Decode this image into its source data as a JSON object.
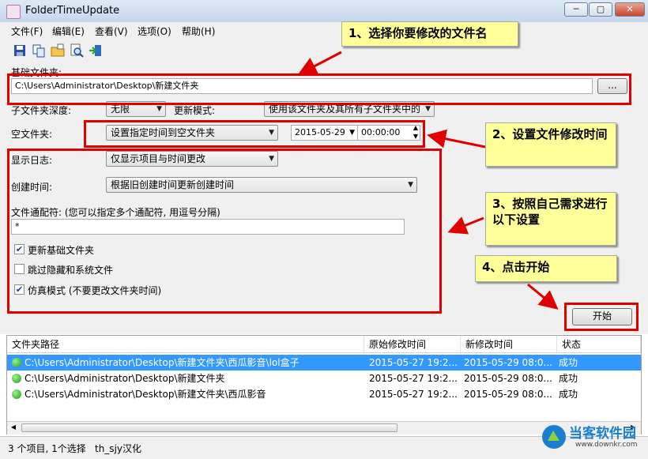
{
  "window": {
    "title": "FolderTimeUpdate"
  },
  "menu": [
    "文件(F)",
    "编辑(E)",
    "查看(V)",
    "选项(O)",
    "帮助(H)"
  ],
  "toolbar_icons": [
    "save-icon",
    "copy-icon",
    "open-folder-icon",
    "search-icon",
    "exit-icon"
  ],
  "form": {
    "base_folder_label": "基础文件夹:",
    "base_folder_value": "C:\\Users\\Administrator\\Desktop\\新建文件夹",
    "browse_label": "...",
    "subfolder_depth_label": "子文件夹深度:",
    "subfolder_depth_value": "无限",
    "update_mode_label": "更新模式:",
    "update_mode_value": "使用该文件夹及其所有子文件夹中的",
    "empty_folder_label": "空文件夹:",
    "empty_folder_value": "设置指定时间到空文件夹",
    "date_value": "2015-05-29",
    "time_value": "00:00:00",
    "log_label": "显示日志:",
    "log_value": "仅显示项目与时间更改",
    "create_time_label": "创建时间:",
    "create_time_value": "根据旧创建时间更新创建时间",
    "wildcard_label": "文件通配符: (您可以指定多个通配符, 用逗号分隔)",
    "wildcard_value": "*",
    "checkboxes": [
      {
        "label": "更新基础文件夹",
        "checked": true
      },
      {
        "label": "跳过隐藏和系统文件",
        "checked": false
      },
      {
        "label": "仿真模式 (不要更改文件夹时间)",
        "checked": true
      }
    ],
    "start_label": "开始"
  },
  "annotations": [
    "1、选择你要修改的文件名",
    "2、设置文件修改时间",
    "3、按照自己需求进行以下设置",
    "4、点击开始"
  ],
  "table": {
    "columns": [
      "文件夹路径",
      "原始修改时间",
      "新修改时间",
      "状态"
    ],
    "rows": [
      {
        "path": "C:\\Users\\Administrator\\Desktop\\新建文件夹\\西瓜影音\\lol盒子",
        "orig": "2015-05-27 19:2...",
        "new": "2015-05-29 08:0...",
        "status": "成功",
        "selected": true
      },
      {
        "path": "C:\\Users\\Administrator\\Desktop\\新建文件夹",
        "orig": "2015-05-27 19:2...",
        "new": "2015-05-29 08:0...",
        "status": "成功",
        "selected": false
      },
      {
        "path": "C:\\Users\\Administrator\\Desktop\\新建文件夹\\西瓜影音",
        "orig": "2015-05-27 19:2...",
        "new": "2015-05-29 08:0...",
        "status": "成功",
        "selected": false
      }
    ]
  },
  "status": {
    "text": "3 个项目, 1个选择",
    "credit": "th_sjy汉化"
  },
  "watermark": {
    "brand": "当客软件园",
    "url": "www.downkr.com"
  },
  "colors": {
    "annotation_red": "#e00000",
    "note_yellow": "#ffff99",
    "selection_blue": "#3399ff"
  }
}
